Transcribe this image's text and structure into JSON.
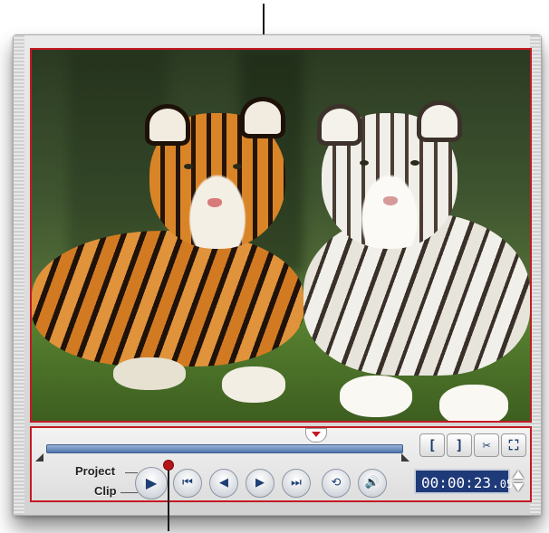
{
  "modes": {
    "project_label": "Project",
    "clip_label": "Clip"
  },
  "edit_buttons": {
    "mark_in": "[",
    "mark_out": "]",
    "split_icon": "scissors-icon",
    "enlarge_icon": "enlarge-preview-icon"
  },
  "playback_buttons": [
    {
      "name": "play",
      "icon": "play-icon"
    },
    {
      "name": "home",
      "icon": "go-to-start-icon"
    },
    {
      "name": "previous-frame",
      "icon": "previous-frame-icon"
    },
    {
      "name": "next-frame",
      "icon": "next-frame-icon"
    },
    {
      "name": "end",
      "icon": "go-to-end-icon"
    },
    {
      "name": "repeat",
      "icon": "repeat-icon"
    },
    {
      "name": "volume",
      "icon": "volume-icon"
    }
  ],
  "timecode": {
    "main": "00:00:23.",
    "frames": "05"
  },
  "colors": {
    "accent": "#c41a22",
    "timecode_bg": "#1f3a78",
    "scrubber": "#4f74ac"
  }
}
